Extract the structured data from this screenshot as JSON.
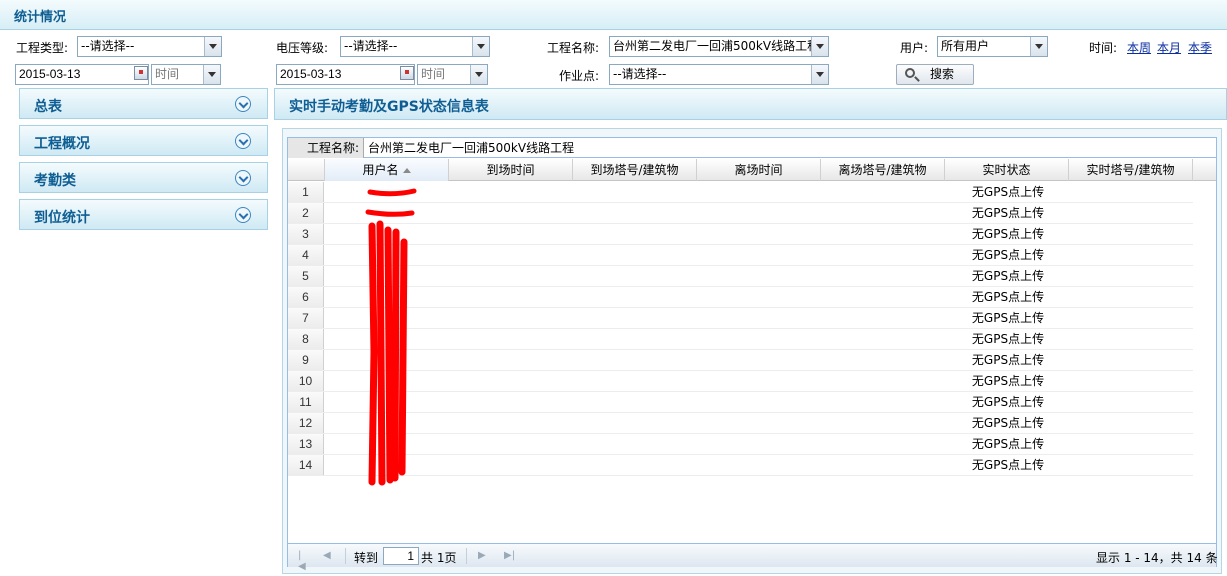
{
  "header": {
    "title": "统计情况"
  },
  "filters": {
    "project_type_label": "工程类型:",
    "project_type_value": "--请选择--",
    "voltage_label": "电压等级:",
    "voltage_value": "--请选择--",
    "project_name_label": "工程名称:",
    "project_name_value": "台州第二发电厂一回浦500kV线路工程",
    "user_label": "用户:",
    "user_value": "所有用户",
    "time_label": "时间:",
    "time_links": [
      "本周",
      "本月",
      "本季"
    ],
    "start_date": "2015-03-13",
    "start_time_placeholder": "时间",
    "end_date": "2015-03-13",
    "end_time_placeholder": "时间",
    "work_point_label": "作业点:",
    "work_point_value": "--请选择--",
    "search_button": "搜索"
  },
  "sidebar": {
    "items": [
      {
        "label": "总表"
      },
      {
        "label": "工程概况"
      },
      {
        "label": "考勤类"
      },
      {
        "label": "到位统计"
      }
    ]
  },
  "panel": {
    "title": "实时手动考勤及GPS状态信息表",
    "project_caption_label": "工程名称:",
    "project_caption_value": "台州第二发电厂一回浦500kV线路工程"
  },
  "table": {
    "columns": [
      "用户名",
      "到场时间",
      "到场塔号/建筑物",
      "离场时间",
      "离场塔号/建筑物",
      "实时状态",
      "实时塔号/建筑物"
    ],
    "sorted_column": "用户名",
    "rows": [
      {
        "num": "1",
        "status": "无GPS点上传"
      },
      {
        "num": "2",
        "status": "无GPS点上传"
      },
      {
        "num": "3",
        "status": "无GPS点上传"
      },
      {
        "num": "4",
        "status": "无GPS点上传"
      },
      {
        "num": "5",
        "status": "无GPS点上传"
      },
      {
        "num": "6",
        "status": "无GPS点上传"
      },
      {
        "num": "7",
        "status": "无GPS点上传"
      },
      {
        "num": "8",
        "status": "无GPS点上传"
      },
      {
        "num": "9",
        "status": "无GPS点上传"
      },
      {
        "num": "10",
        "status": "无GPS点上传"
      },
      {
        "num": "11",
        "status": "无GPS点上传"
      },
      {
        "num": "12",
        "status": "无GPS点上传"
      },
      {
        "num": "13",
        "status": "无GPS点上传"
      },
      {
        "num": "14",
        "status": "无GPS点上传"
      }
    ]
  },
  "pager": {
    "goto_label": "转到",
    "page_value": "1",
    "total_pages": "共 1页",
    "summary": "显示 1 - 14，共 14 条"
  },
  "colors": {
    "accent": "#0f5e93",
    "link": "#0a2ea0",
    "redaction": "#ff0000"
  }
}
